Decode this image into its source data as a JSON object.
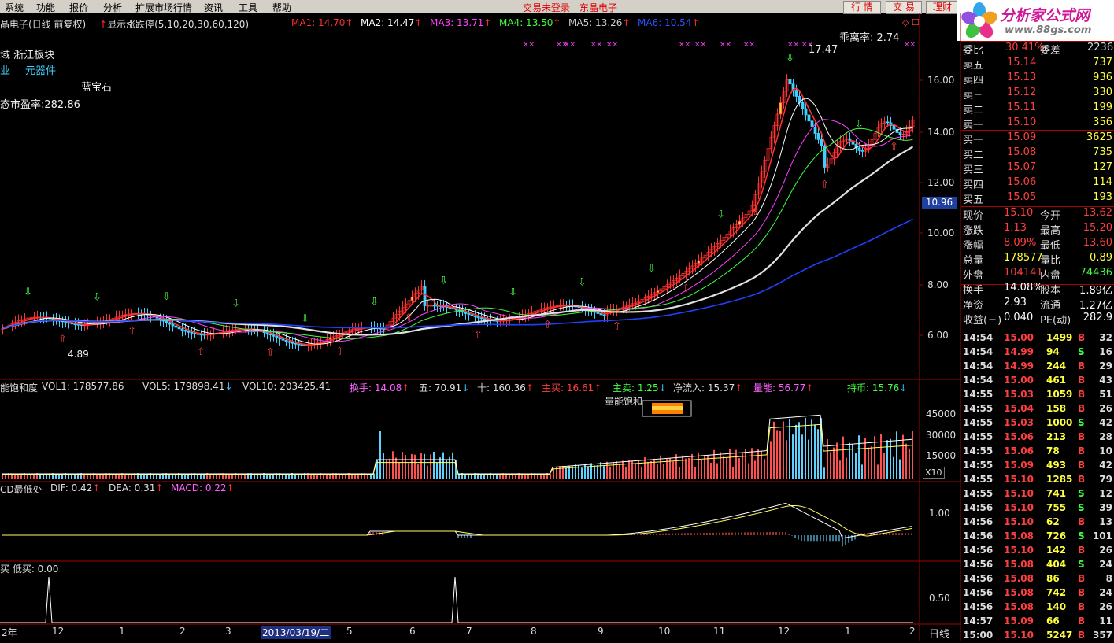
{
  "menu": {
    "items": [
      "系统",
      "功能",
      "报价",
      "分析",
      "扩展市场行情",
      "资讯",
      "工具",
      "帮助"
    ],
    "status1": "交易未登录",
    "status2": "东晶电子",
    "btn_quote": "行 情",
    "btn_trade": "交 易",
    "btn_finance": "理财"
  },
  "logo": {
    "line1": "分析家公式网",
    "line2": "www.88gs.com"
  },
  "main": {
    "stock_title": "晶电子(日线 前复权)",
    "limit_label": "显示涨跌停(5,10,20,30,60,120)",
    "ma": [
      {
        "label": "MA1: 14.70",
        "color": "#ff3030"
      },
      {
        "label": "MA2: 14.47",
        "color": "#ffffff"
      },
      {
        "label": "MA3: 13.71",
        "color": "#ff40ff"
      },
      {
        "label": "MA4: 13.50",
        "color": "#40ff40"
      },
      {
        "label": "MA5: 13.26",
        "color": "#cccccc"
      },
      {
        "label": "MA6: 10.54",
        "color": "#3050ff"
      }
    ],
    "region": "域 浙江板块",
    "industry1": "业",
    "industry2": "元器件",
    "concept": "蓝宝石",
    "pe": "态市盈率:282.86",
    "bias": "乖离率: 2.74",
    "high_mark": "17.47",
    "low_mark": "4.89",
    "price_axis": [
      "16.00",
      "14.00",
      "12.00",
      "10.00",
      "8.00",
      "6.00"
    ],
    "current_price_tag": "10.96"
  },
  "vol": {
    "title": "能饱和度",
    "vol1": "VOL1: 178577.86",
    "vol5": "VOL5: 179898.41",
    "vol10": "VOL10: 203425.41",
    "huanshou": "换手: 14.08",
    "wu": "五: 70.91",
    "shi": "十: 160.36",
    "zhumai": "主买: 16.61",
    "zhumai2": "主卖: 1.25",
    "jingliuru": "净流入: 15.37",
    "liangneng": "量能: 56.77",
    "chibi": "持币: 15.76",
    "saturation_label": "量能饱和",
    "axis": [
      "45000",
      "30000",
      "15000"
    ],
    "unit": "X10"
  },
  "macd": {
    "title": "CD最低处",
    "dif": "DIF: 0.42",
    "dea": "DEA: 0.31",
    "macd": "MACD: 0.22",
    "axis": "1.00"
  },
  "low": {
    "title": "买 低买: 0.00",
    "axis": "0.50"
  },
  "timeline": {
    "labels": [
      "2年",
      "12",
      "1",
      "2",
      "3",
      "2013/03/19/二",
      "5",
      "6",
      "7",
      "8",
      "9",
      "10",
      "11",
      "12",
      "1",
      "2"
    ],
    "period": "日线"
  },
  "order_book": {
    "top_label": "委比",
    "top_val": "30.41%",
    "top_label2": "委差",
    "top_val2": "2236",
    "asks": [
      {
        "name": "卖五",
        "price": "15.14",
        "vol": "737"
      },
      {
        "name": "卖四",
        "price": "15.13",
        "vol": "936"
      },
      {
        "name": "卖三",
        "price": "15.12",
        "vol": "330"
      },
      {
        "name": "卖二",
        "price": "15.11",
        "vol": "199"
      },
      {
        "name": "卖一",
        "price": "15.10",
        "vol": "356"
      }
    ],
    "bids": [
      {
        "name": "买一",
        "price": "15.09",
        "vol": "3625"
      },
      {
        "name": "买二",
        "price": "15.08",
        "vol": "735"
      },
      {
        "name": "买三",
        "price": "15.07",
        "vol": "127"
      },
      {
        "name": "买四",
        "price": "15.06",
        "vol": "114"
      },
      {
        "name": "买五",
        "price": "15.05",
        "vol": "193"
      }
    ]
  },
  "quote": [
    {
      "l1": "现价",
      "v1": "15.10",
      "c1": "#ff4040",
      "l2": "今开",
      "v2": "13.62",
      "c2": "#ff4040"
    },
    {
      "l1": "涨跌",
      "v1": "1.13",
      "c1": "#ff4040",
      "l2": "最高",
      "v2": "15.20",
      "c2": "#ff4040"
    },
    {
      "l1": "涨幅",
      "v1": "8.09%",
      "c1": "#ff4040",
      "l2": "最低",
      "v2": "13.60",
      "c2": "#ff4040"
    },
    {
      "l1": "总量",
      "v1": "178577",
      "c1": "#ffff40",
      "l2": "量比",
      "v2": "0.89",
      "c2": "#ffff40"
    },
    {
      "l1": "外盘",
      "v1": "104141",
      "c1": "#ff4040",
      "l2": "内盘",
      "v2": "74436",
      "c2": "#40ff40"
    },
    {
      "l1": "换手",
      "v1": "14.08%",
      "c1": "#ffffff",
      "l2": "股本",
      "v2": "1.89亿",
      "c2": "#ffffff"
    },
    {
      "l1": "净资",
      "v1": "2.93",
      "c1": "#ffffff",
      "l2": "流通",
      "v2": "1.27亿",
      "c2": "#ffffff"
    },
    {
      "l1": "收益(三)",
      "v1": "0.040",
      "c1": "#ffffff",
      "l2": "PE(动)",
      "v2": "282.9",
      "c2": "#ffffff"
    }
  ],
  "ticks": [
    [
      "14:54",
      "15.00",
      "1499",
      "B",
      "32"
    ],
    [
      "14:54",
      "14.99",
      "94",
      "S",
      "16"
    ],
    [
      "14:54",
      "14.99",
      "244",
      "B",
      "29"
    ],
    [
      "14:54",
      "15.00",
      "461",
      "B",
      "43"
    ],
    [
      "14:55",
      "15.03",
      "1059",
      "B",
      "51"
    ],
    [
      "14:55",
      "15.04",
      "158",
      "B",
      "26"
    ],
    [
      "14:55",
      "15.03",
      "1000",
      "S",
      "42"
    ],
    [
      "14:55",
      "15.06",
      "213",
      "B",
      "28"
    ],
    [
      "14:55",
      "15.06",
      "78",
      "B",
      "10"
    ],
    [
      "14:55",
      "15.09",
      "493",
      "B",
      "42"
    ],
    [
      "14:55",
      "15.10",
      "1285",
      "B",
      "79"
    ],
    [
      "14:55",
      "15.10",
      "741",
      "S",
      "12"
    ],
    [
      "14:56",
      "15.10",
      "755",
      "S",
      "39"
    ],
    [
      "14:56",
      "15.10",
      "62",
      "B",
      "13"
    ],
    [
      "14:56",
      "15.08",
      "726",
      "S",
      "101"
    ],
    [
      "14:56",
      "15.10",
      "142",
      "B",
      "26"
    ],
    [
      "14:56",
      "15.08",
      "404",
      "S",
      "24"
    ],
    [
      "14:56",
      "15.08",
      "86",
      "B",
      "8"
    ],
    [
      "14:56",
      "15.08",
      "742",
      "B",
      "24"
    ],
    [
      "14:56",
      "15.08",
      "140",
      "B",
      "26"
    ],
    [
      "14:57",
      "15.09",
      "66",
      "B",
      "11"
    ],
    [
      "15:00",
      "15.10",
      "5247",
      "B",
      "357"
    ]
  ]
}
